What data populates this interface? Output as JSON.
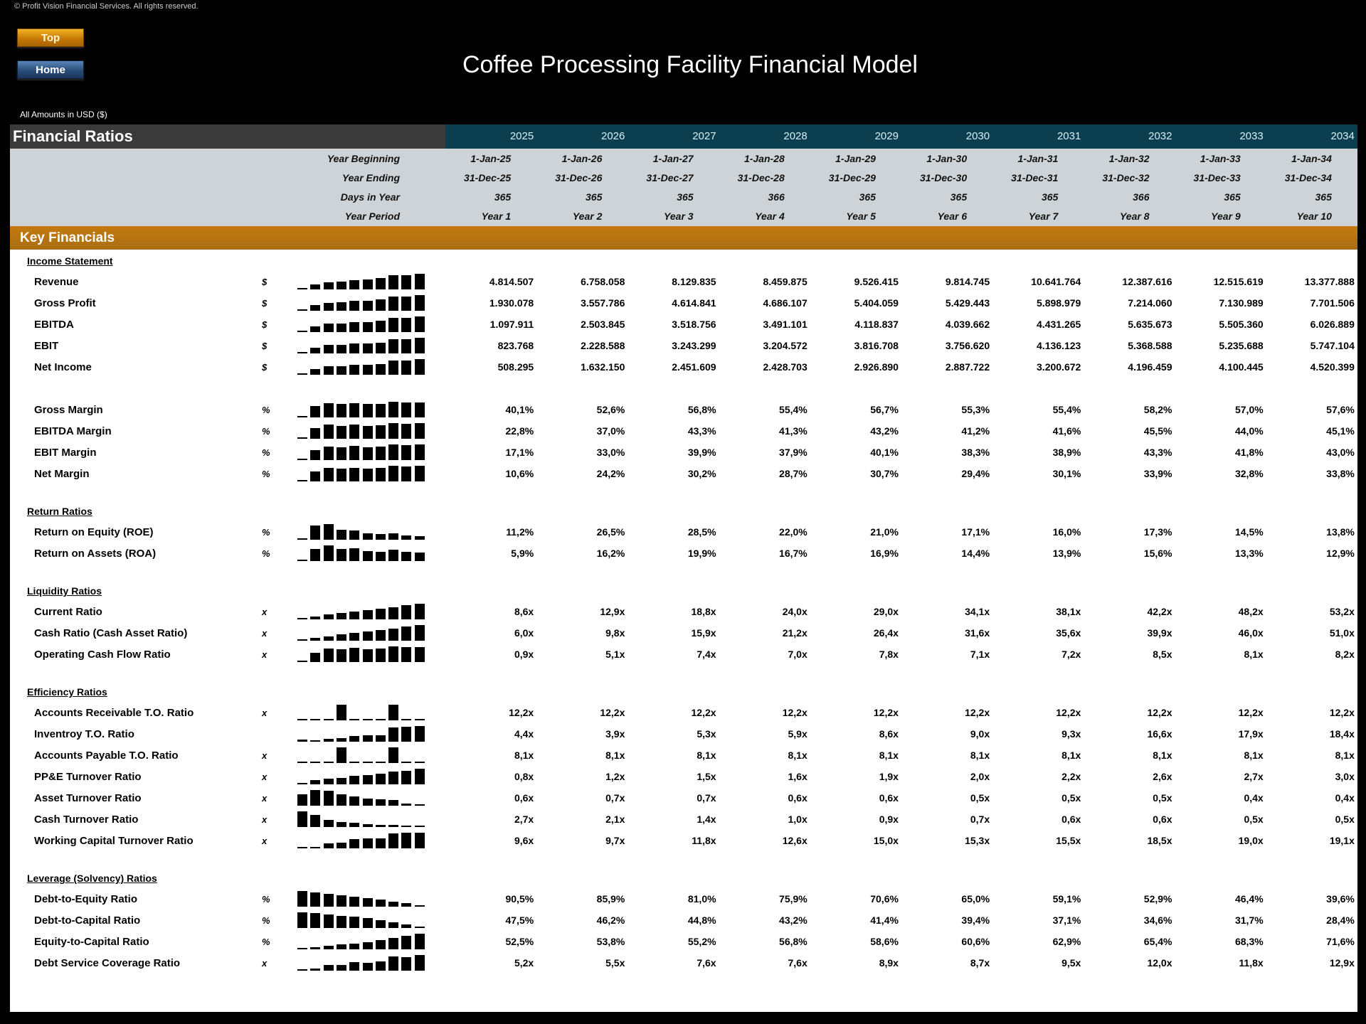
{
  "copyright": "© Profit Vision Financial Services. All rights reserved.",
  "nav": {
    "top_label": "Top",
    "home_label": "Home"
  },
  "title": "Coffee Processing Facility Financial Model",
  "amounts_note": "All Amounts in  USD ($)",
  "section_header": "Financial Ratios",
  "years": [
    "2025",
    "2026",
    "2027",
    "2028",
    "2029",
    "2030",
    "2031",
    "2032",
    "2033",
    "2034"
  ],
  "meta_rows": [
    {
      "label": "Year Beginning",
      "values": [
        "1-Jan-25",
        "1-Jan-26",
        "1-Jan-27",
        "1-Jan-28",
        "1-Jan-29",
        "1-Jan-30",
        "1-Jan-31",
        "1-Jan-32",
        "1-Jan-33",
        "1-Jan-34"
      ]
    },
    {
      "label": "Year Ending",
      "values": [
        "31-Dec-25",
        "31-Dec-26",
        "31-Dec-27",
        "31-Dec-28",
        "31-Dec-29",
        "31-Dec-30",
        "31-Dec-31",
        "31-Dec-32",
        "31-Dec-33",
        "31-Dec-34"
      ]
    },
    {
      "label": "Days in Year",
      "values": [
        "365",
        "365",
        "365",
        "366",
        "365",
        "365",
        "365",
        "366",
        "365",
        "365"
      ]
    },
    {
      "label": "Year Period",
      "values": [
        "Year 1",
        "Year 2",
        "Year 3",
        "Year 4",
        "Year 5",
        "Year 6",
        "Year 7",
        "Year 8",
        "Year 9",
        "Year 10"
      ]
    }
  ],
  "band_title": "Key Financials",
  "sections": [
    {
      "title": "Income Statement",
      "rows": [
        {
          "label": "Revenue",
          "unit": "$",
          "values": [
            "4.814.507",
            "6.758.058",
            "8.129.835",
            "8.459.875",
            "9.526.415",
            "9.814.745",
            "10.641.764",
            "12.387.616",
            "12.515.619",
            "13.377.888"
          ],
          "spark": [
            4814507,
            6758058,
            8129835,
            8459875,
            9526415,
            9814745,
            10641764,
            12387616,
            12515619,
            13377888
          ]
        },
        {
          "label": "Gross Profit",
          "unit": "$",
          "values": [
            "1.930.078",
            "3.557.786",
            "4.614.841",
            "4.686.107",
            "5.404.059",
            "5.429.443",
            "5.898.979",
            "7.214.060",
            "7.130.989",
            "7.701.506"
          ],
          "spark": [
            1930078,
            3557786,
            4614841,
            4686107,
            5404059,
            5429443,
            5898979,
            7214060,
            7130989,
            7701506
          ]
        },
        {
          "label": "EBITDA",
          "unit": "$",
          "values": [
            "1.097.911",
            "2.503.845",
            "3.518.756",
            "3.491.101",
            "4.118.837",
            "4.039.662",
            "4.431.265",
            "5.635.673",
            "5.505.360",
            "6.026.889"
          ],
          "spark": [
            1097911,
            2503845,
            3518756,
            3491101,
            4118837,
            4039662,
            4431265,
            5635673,
            5505360,
            6026889
          ]
        },
        {
          "label": "EBIT",
          "unit": "$",
          "values": [
            "823.768",
            "2.228.588",
            "3.243.299",
            "3.204.572",
            "3.816.708",
            "3.756.620",
            "4.136.123",
            "5.368.588",
            "5.235.688",
            "5.747.104"
          ],
          "spark": [
            823768,
            2228588,
            3243299,
            3204572,
            3816708,
            3756620,
            4136123,
            5368588,
            5235688,
            5747104
          ]
        },
        {
          "label": "Net Income",
          "unit": "$",
          "values": [
            "508.295",
            "1.632.150",
            "2.451.609",
            "2.428.703",
            "2.926.890",
            "2.887.722",
            "3.200.672",
            "4.196.459",
            "4.100.445",
            "4.520.399"
          ],
          "spark": [
            508295,
            1632150,
            2451609,
            2428703,
            2926890,
            2887722,
            3200672,
            4196459,
            4100445,
            4520399
          ]
        },
        {
          "gap": true
        },
        {
          "label": "Gross Margin",
          "unit": "%",
          "values": [
            "40,1%",
            "52,6%",
            "56,8%",
            "55,4%",
            "56,7%",
            "55,3%",
            "55,4%",
            "58,2%",
            "57,0%",
            "57,6%"
          ],
          "spark": [
            40.1,
            52.6,
            56.8,
            55.4,
            56.7,
            55.3,
            55.4,
            58.2,
            57.0,
            57.6
          ]
        },
        {
          "label": "EBITDA Margin",
          "unit": "%",
          "values": [
            "22,8%",
            "37,0%",
            "43,3%",
            "41,3%",
            "43,2%",
            "41,2%",
            "41,6%",
            "45,5%",
            "44,0%",
            "45,1%"
          ],
          "spark": [
            22.8,
            37.0,
            43.3,
            41.3,
            43.2,
            41.2,
            41.6,
            45.5,
            44.0,
            45.1
          ]
        },
        {
          "label": "EBIT Margin",
          "unit": "%",
          "values": [
            "17,1%",
            "33,0%",
            "39,9%",
            "37,9%",
            "40,1%",
            "38,3%",
            "38,9%",
            "43,3%",
            "41,8%",
            "43,0%"
          ],
          "spark": [
            17.1,
            33.0,
            39.9,
            37.9,
            40.1,
            38.3,
            38.9,
            43.3,
            41.8,
            43.0
          ]
        },
        {
          "label": "Net Margin",
          "unit": "%",
          "values": [
            "10,6%",
            "24,2%",
            "30,2%",
            "28,7%",
            "30,7%",
            "29,4%",
            "30,1%",
            "33,9%",
            "32,8%",
            "33,8%"
          ],
          "spark": [
            10.6,
            24.2,
            30.2,
            28.7,
            30.7,
            29.4,
            30.1,
            33.9,
            32.8,
            33.8
          ]
        }
      ]
    },
    {
      "title": "Return Ratios",
      "rows": [
        {
          "label": "Return on Equity (ROE)",
          "unit": "%",
          "values": [
            "11,2%",
            "26,5%",
            "28,5%",
            "22,0%",
            "21,0%",
            "17,1%",
            "16,0%",
            "17,3%",
            "14,5%",
            "13,8%"
          ],
          "spark": [
            11.2,
            26.5,
            28.5,
            22.0,
            21.0,
            17.1,
            16.0,
            17.3,
            14.5,
            13.8
          ]
        },
        {
          "label": "Return on Assets (ROA)",
          "unit": "%",
          "values": [
            "5,9%",
            "16,2%",
            "19,9%",
            "16,7%",
            "16,9%",
            "14,4%",
            "13,9%",
            "15,6%",
            "13,3%",
            "12,9%"
          ],
          "spark": [
            5.9,
            16.2,
            19.9,
            16.7,
            16.9,
            14.4,
            13.9,
            15.6,
            13.3,
            12.9
          ]
        }
      ]
    },
    {
      "title": "Liquidity Ratios",
      "rows": [
        {
          "label": "Current Ratio",
          "unit": "x",
          "values": [
            "8,6x",
            "12,9x",
            "18,8x",
            "24,0x",
            "29,0x",
            "34,1x",
            "38,1x",
            "42,2x",
            "48,2x",
            "53,2x"
          ],
          "spark": [
            8.6,
            12.9,
            18.8,
            24.0,
            29.0,
            34.1,
            38.1,
            42.2,
            48.2,
            53.2
          ]
        },
        {
          "label": "Cash Ratio (Cash Asset Ratio)",
          "unit": "x",
          "values": [
            "6,0x",
            "9,8x",
            "15,9x",
            "21,2x",
            "26,4x",
            "31,6x",
            "35,6x",
            "39,9x",
            "46,0x",
            "51,0x"
          ],
          "spark": [
            6.0,
            9.8,
            15.9,
            21.2,
            26.4,
            31.6,
            35.6,
            39.9,
            46.0,
            51.0
          ]
        },
        {
          "label": "Operating Cash Flow Ratio",
          "unit": "x",
          "values": [
            "0,9x",
            "5,1x",
            "7,4x",
            "7,0x",
            "7,8x",
            "7,1x",
            "7,2x",
            "8,5x",
            "8,1x",
            "8,2x"
          ],
          "spark": [
            0.9,
            5.1,
            7.4,
            7.0,
            7.8,
            7.1,
            7.2,
            8.5,
            8.1,
            8.2
          ]
        }
      ]
    },
    {
      "title": "Efficiency Ratios",
      "rows": [
        {
          "label": "Accounts Receivable T.O. Ratio",
          "unit": "x",
          "values": [
            "12,2x",
            "12,2x",
            "12,2x",
            "12,2x",
            "12,2x",
            "12,2x",
            "12,2x",
            "12,2x",
            "12,2x",
            "12,2x"
          ],
          "spark": [
            0,
            0,
            0,
            1,
            0,
            0,
            0,
            1,
            0,
            0
          ]
        },
        {
          "label": "Inventroy T.O. Ratio",
          "unit": "",
          "values": [
            "4,4x",
            "3,9x",
            "5,3x",
            "5,9x",
            "8,6x",
            "9,0x",
            "9,3x",
            "16,6x",
            "17,9x",
            "18,4x"
          ],
          "spark": [
            4.4,
            3.9,
            5.3,
            5.9,
            8.6,
            9.0,
            9.3,
            16.6,
            17.9,
            18.4
          ]
        },
        {
          "label": "Accounts Payable T.O. Ratio",
          "unit": "x",
          "values": [
            "8,1x",
            "8,1x",
            "8,1x",
            "8,1x",
            "8,1x",
            "8,1x",
            "8,1x",
            "8,1x",
            "8,1x",
            "8,1x"
          ],
          "spark": [
            0,
            0,
            0,
            1,
            0,
            0,
            0,
            1,
            0,
            0
          ]
        },
        {
          "label": "PP&E Turnover Ratio",
          "unit": "x",
          "values": [
            "0,8x",
            "1,2x",
            "1,5x",
            "1,6x",
            "1,9x",
            "2,0x",
            "2,2x",
            "2,6x",
            "2,7x",
            "3,0x"
          ],
          "spark": [
            0.8,
            1.2,
            1.5,
            1.6,
            1.9,
            2.0,
            2.2,
            2.6,
            2.7,
            3.0
          ]
        },
        {
          "label": "Asset Turnover Ratio",
          "unit": "x",
          "values": [
            "0,6x",
            "0,7x",
            "0,7x",
            "0,6x",
            "0,6x",
            "0,5x",
            "0,5x",
            "0,5x",
            "0,4x",
            "0,4x"
          ],
          "spark": [
            0.62,
            0.72,
            0.71,
            0.63,
            0.58,
            0.53,
            0.51,
            0.5,
            0.42,
            0.4
          ]
        },
        {
          "label": "Cash Turnover Ratio",
          "unit": "x",
          "values": [
            "2,7x",
            "2,1x",
            "1,4x",
            "1,0x",
            "0,9x",
            "0,7x",
            "0,6x",
            "0,6x",
            "0,5x",
            "0,5x"
          ],
          "spark": [
            2.7,
            2.1,
            1.4,
            1.0,
            0.9,
            0.7,
            0.6,
            0.6,
            0.5,
            0.5
          ]
        },
        {
          "label": "Working Capital Turnover Ratio",
          "unit": "x",
          "values": [
            "9,6x",
            "9,7x",
            "11,8x",
            "12,6x",
            "15,0x",
            "15,3x",
            "15,5x",
            "18,5x",
            "19,0x",
            "19,1x"
          ],
          "spark": [
            9.6,
            9.7,
            11.8,
            12.6,
            15.0,
            15.3,
            15.5,
            18.5,
            19.0,
            19.1
          ]
        }
      ]
    },
    {
      "title": "Leverage (Solvency) Ratios",
      "rows": [
        {
          "label": "Debt-to-Equity Ratio",
          "unit": "%",
          "values": [
            "90,5%",
            "85,9%",
            "81,0%",
            "75,9%",
            "70,6%",
            "65,0%",
            "59,1%",
            "52,9%",
            "46,4%",
            "39,6%"
          ],
          "spark": [
            90.5,
            85.9,
            81.0,
            75.9,
            70.6,
            65.0,
            59.1,
            52.9,
            46.4,
            39.6
          ]
        },
        {
          "label": "Debt-to-Capital Ratio",
          "unit": "%",
          "values": [
            "47,5%",
            "46,2%",
            "44,8%",
            "43,2%",
            "41,4%",
            "39,4%",
            "37,1%",
            "34,6%",
            "31,7%",
            "28,4%"
          ],
          "spark": [
            47.5,
            46.2,
            44.8,
            43.2,
            41.4,
            39.4,
            37.1,
            34.6,
            31.7,
            28.4
          ]
        },
        {
          "label": "Equity-to-Capital Ratio",
          "unit": "%",
          "values": [
            "52,5%",
            "53,8%",
            "55,2%",
            "56,8%",
            "58,6%",
            "60,6%",
            "62,9%",
            "65,4%",
            "68,3%",
            "71,6%"
          ],
          "spark": [
            52.5,
            53.8,
            55.2,
            56.8,
            58.6,
            60.6,
            62.9,
            65.4,
            68.3,
            71.6
          ]
        },
        {
          "label": "Debt Service Coverage Ratio",
          "unit": "x",
          "values": [
            "5,2x",
            "5,5x",
            "7,6x",
            "7,6x",
            "8,9x",
            "8,7x",
            "9,5x",
            "12,0x",
            "11,8x",
            "12,9x"
          ],
          "spark": [
            5.2,
            5.5,
            7.6,
            7.6,
            8.9,
            8.7,
            9.5,
            12.0,
            11.8,
            12.9
          ]
        }
      ]
    }
  ]
}
